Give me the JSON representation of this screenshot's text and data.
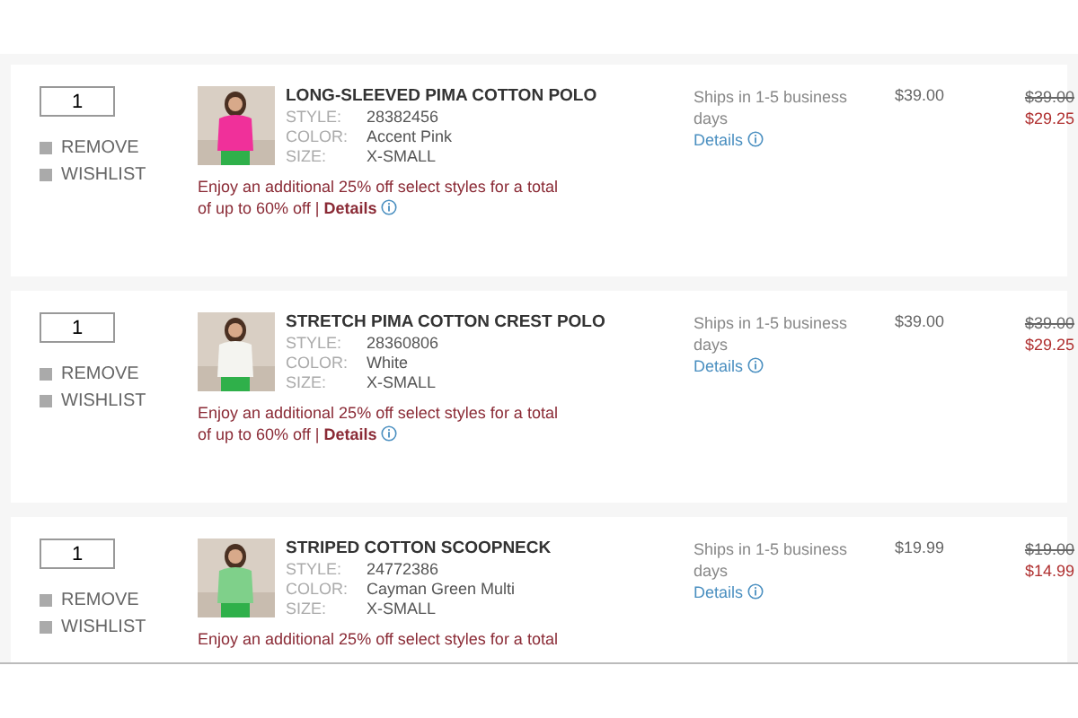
{
  "items": [
    {
      "quantity": "1",
      "actions": [
        "REMOVE",
        "WISHLIST"
      ],
      "title": "LONG-SLEEVED PIMA COTTON POLO",
      "specs": [
        {
          "label": "STYLE:",
          "value": "28382456"
        },
        {
          "label": "COLOR:",
          "value": "Accent Pink"
        },
        {
          "label": "SIZE:",
          "value": "X-SMALL"
        }
      ],
      "promo": {
        "lines": [
          "Enjoy an additional 25% off select styles for a total",
          "of up to 60% off | "
        ],
        "link": "Details"
      },
      "shipping": "Ships in 1-5 business days",
      "shipping_link": "Details",
      "price": "$39.00",
      "original_price": "$39.00",
      "sale_price": "$29.25"
    },
    {
      "quantity": "1",
      "actions": [
        "REMOVE",
        "WISHLIST"
      ],
      "title": "STRETCH PIMA COTTON CREST POLO",
      "specs": [
        {
          "label": "STYLE:",
          "value": "28360806"
        },
        {
          "label": "COLOR:",
          "value": "White"
        },
        {
          "label": "SIZE:",
          "value": "X-SMALL"
        }
      ],
      "promo": {
        "lines": [
          "Enjoy an additional 25% off select styles for a total",
          "of up to 60% off | "
        ],
        "link": "Details"
      },
      "shipping": "Ships in 1-5 business days",
      "shipping_link": "Details",
      "price": "$39.00",
      "original_price": "$39.00",
      "sale_price": "$29.25"
    },
    {
      "quantity": "1",
      "actions": [
        "REMOVE",
        "WISHLIST"
      ],
      "title": "STRIPED COTTON SCOOPNECK",
      "specs": [
        {
          "label": "STYLE:",
          "value": "24772386"
        },
        {
          "label": "COLOR:",
          "value": "Cayman Green Multi"
        },
        {
          "label": "SIZE:",
          "value": "X-SMALL"
        }
      ],
      "promo": {
        "lines": [
          "Enjoy an additional 25% off select styles for a total"
        ]
      },
      "shipping": "Ships in 1-5 business days",
      "shipping_link": "Details",
      "price": "$19.99",
      "original_price": "$19.00",
      "sale_price": "$14.99"
    }
  ]
}
